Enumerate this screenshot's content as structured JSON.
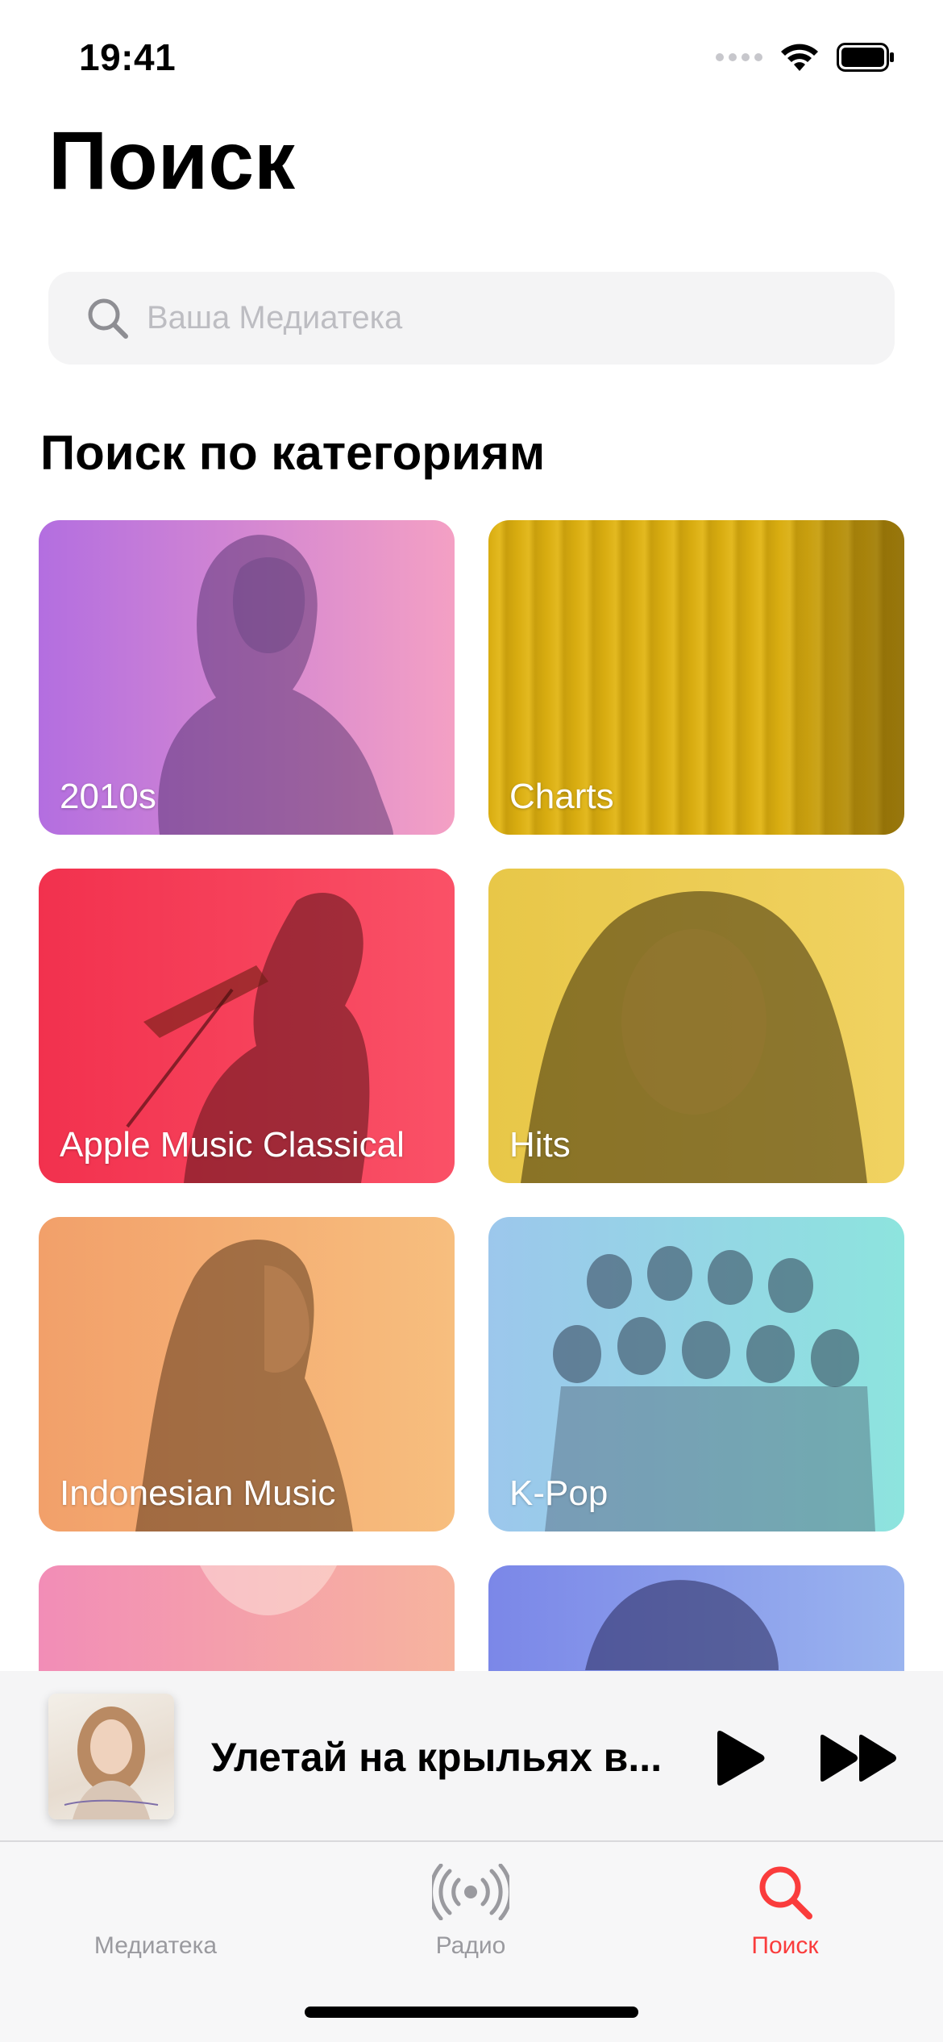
{
  "status_bar": {
    "time": "19:41",
    "icons": [
      "signal-icon",
      "wifi-icon",
      "battery-icon"
    ]
  },
  "page_title": "Поиск",
  "search": {
    "placeholder": "Ваша Медиатека",
    "value": ""
  },
  "section_title": "Поиск по категориям",
  "categories": [
    {
      "label": "2010s",
      "gradient": [
        "#b36ee0",
        "#f4a0c4"
      ]
    },
    {
      "label": "Charts",
      "gradient": [
        "#d9ad12",
        "#a98912"
      ]
    },
    {
      "label": "Apple Music Classical",
      "gradient": [
        "#f2314e",
        "#fa5167"
      ]
    },
    {
      "label": "Hits",
      "gradient": [
        "#e8c748",
        "#f0d261"
      ]
    },
    {
      "label": "Indonesian Music",
      "gradient": [
        "#f2a06a",
        "#f7be7e"
      ]
    },
    {
      "label": "K-Pop",
      "gradient": [
        "#9cc7ec",
        "#8de4de"
      ]
    },
    {
      "label": "",
      "gradient": [
        "#f28db7",
        "#f7b49e"
      ]
    },
    {
      "label": "",
      "gradient": [
        "#7b87e8",
        "#9ab4ef"
      ]
    }
  ],
  "mini_player": {
    "title": "Улетай на крыльях в..."
  },
  "tab_bar": {
    "tabs": [
      {
        "label": "Медиатека",
        "icon": "library-icon",
        "active": false
      },
      {
        "label": "Радио",
        "icon": "radio-icon",
        "active": false
      },
      {
        "label": "Поиск",
        "icon": "search-icon",
        "active": true
      }
    ]
  },
  "colors": {
    "accent": "#fa3c3c",
    "inactive": "#9a9a9f"
  }
}
